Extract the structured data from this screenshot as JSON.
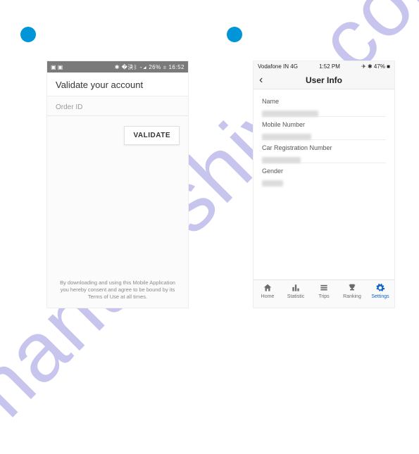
{
  "watermark": "manualshive.com",
  "phone1": {
    "status_left": "▣ ▣",
    "status_right": "✱ �決ᛒ ▿◢ 26% ▯ 16:52",
    "title": "Validate your account",
    "field_label": "Order ID",
    "button": "VALIDATE",
    "footer_l1": "By downloading and using this Mobile Application",
    "footer_l2": "you hereby consent and agree to be bound by its",
    "footer_l3": "Terms of Use at all times."
  },
  "phone2": {
    "status_left": "Vodafone IN   4G",
    "status_center": "1:52 PM",
    "status_right": "✈ ✱ 47% ■",
    "nav_back_glyph": "‹",
    "nav_title": "User Info",
    "fields": {
      "name": "Name",
      "mobile": "Mobile Number",
      "car": "Car Registration Number",
      "gender": "Gender"
    },
    "tabs": {
      "home": "Home",
      "statistic": "Statistic",
      "trips": "Trips",
      "ranking": "Ranking",
      "settings": "Settings"
    }
  }
}
